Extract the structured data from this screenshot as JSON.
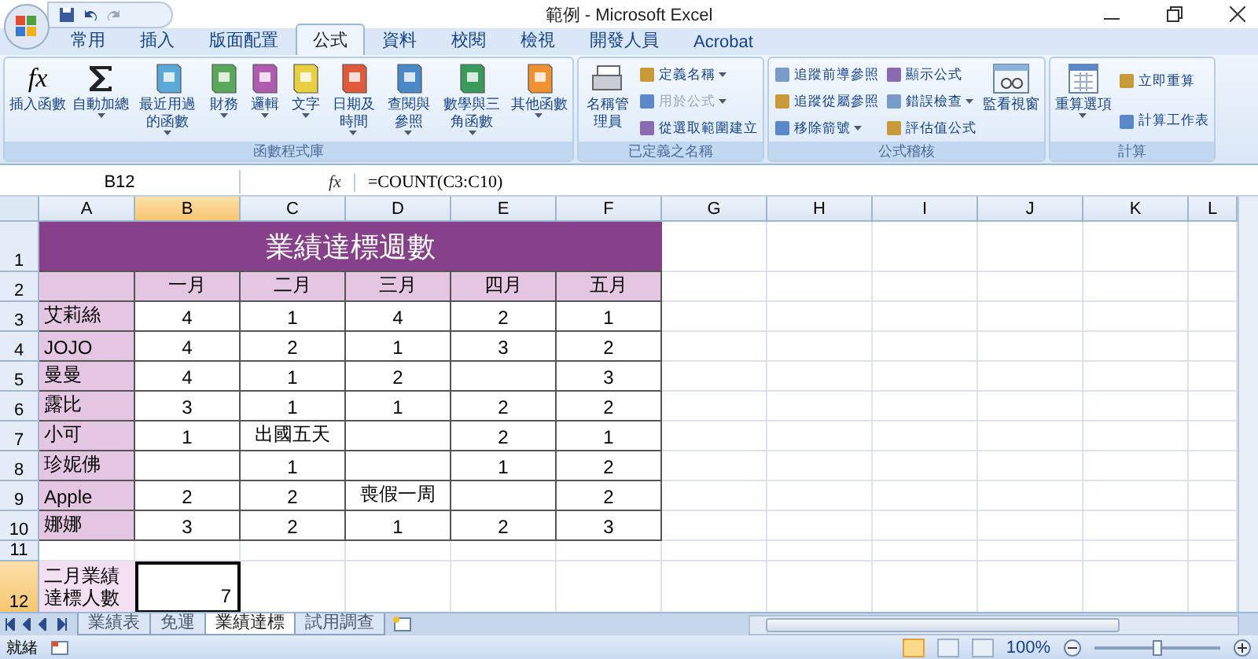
{
  "window": {
    "title": "範例 - Microsoft Excel"
  },
  "tabs": [
    {
      "label": "常用",
      "selected": false
    },
    {
      "label": "插入",
      "selected": false
    },
    {
      "label": "版面配置",
      "selected": false
    },
    {
      "label": "公式",
      "selected": true
    },
    {
      "label": "資料",
      "selected": false
    },
    {
      "label": "校閱",
      "selected": false
    },
    {
      "label": "檢視",
      "selected": false
    },
    {
      "label": "開發人員",
      "selected": false
    },
    {
      "label": "Acrobat",
      "selected": false
    }
  ],
  "ribbon": [
    {
      "label": "函數程式庫",
      "items": [
        {
          "kind": "fx",
          "glyph": "fx",
          "label": "插入函數",
          "dropdown": false
        },
        {
          "kind": "sum",
          "label": "自動加總",
          "dropdown": true
        },
        {
          "kind": "book",
          "color": "#5aa8d8",
          "label": "最近用過的函數",
          "dropdown": true
        },
        {
          "kind": "book",
          "color": "#5aa85a",
          "label": "財務",
          "dropdown": true
        },
        {
          "kind": "book",
          "color": "#b05ab0",
          "label": "邏輯",
          "dropdown": true
        },
        {
          "kind": "book",
          "color": "#e8d040",
          "label": "文字",
          "dropdown": true
        },
        {
          "kind": "book",
          "color": "#e05a3a",
          "label": "日期及時間",
          "dropdown": true
        },
        {
          "kind": "book",
          "color": "#4a88c8",
          "label": "查閱與參照",
          "dropdown": true
        },
        {
          "kind": "book",
          "color": "#3a9a5a",
          "label": "數學與三角函數",
          "dropdown": true
        },
        {
          "kind": "book",
          "color": "#f09030",
          "label": "其他函數",
          "dropdown": true
        }
      ]
    },
    {
      "label": "已定義之名稱",
      "items": [
        {
          "kind": "names",
          "label": "名稱管理員",
          "dropdown": false
        },
        {
          "kind": "small",
          "label": "定義名稱",
          "dropdown": true,
          "disabled": false
        },
        {
          "kind": "small",
          "label": "用於公式",
          "dropdown": true,
          "disabled": true
        },
        {
          "kind": "small",
          "label": "從選取範圍建立",
          "dropdown": false,
          "disabled": false
        }
      ]
    },
    {
      "label": "公式稽核",
      "items": [
        {
          "kind": "small",
          "label": "追蹤前導參照",
          "dropdown": false,
          "disabled": false
        },
        {
          "kind": "small",
          "label": "追蹤從屬參照",
          "dropdown": false,
          "disabled": false
        },
        {
          "kind": "small",
          "label": "移除箭號",
          "dropdown": true,
          "disabled": false
        },
        {
          "kind": "small",
          "label": "顯示公式",
          "dropdown": false,
          "disabled": false
        },
        {
          "kind": "small",
          "label": "錯誤檢查",
          "dropdown": true,
          "disabled": false
        },
        {
          "kind": "small",
          "label": "評估值公式",
          "dropdown": false,
          "disabled": false
        },
        {
          "kind": "watch",
          "label": "監看視窗",
          "dropdown": false
        }
      ]
    },
    {
      "label": "計算",
      "items": [
        {
          "kind": "calc",
          "label": "重算選項",
          "dropdown": true
        },
        {
          "kind": "small",
          "label": "立即重算",
          "dropdown": false,
          "disabled": false
        },
        {
          "kind": "small",
          "label": "計算工作表",
          "dropdown": false,
          "disabled": false
        }
      ]
    }
  ],
  "formula_bar": {
    "name_box": "B12",
    "button": "fx",
    "formula": "=COUNT(C3:C10)"
  },
  "columns": [
    {
      "label": "A",
      "selected": false
    },
    {
      "label": "B",
      "selected": true
    },
    {
      "label": "C",
      "selected": false
    },
    {
      "label": "D",
      "selected": false
    },
    {
      "label": "E",
      "selected": false
    },
    {
      "label": "F",
      "selected": false
    },
    {
      "label": "G",
      "selected": false
    },
    {
      "label": "H",
      "selected": false
    },
    {
      "label": "I",
      "selected": false
    },
    {
      "label": "J",
      "selected": false
    },
    {
      "label": "K",
      "selected": false
    },
    {
      "label": "L",
      "selected": false
    }
  ],
  "rows": [
    {
      "label": "1",
      "selected": false
    },
    {
      "label": "2",
      "selected": false
    },
    {
      "label": "3",
      "selected": false
    },
    {
      "label": "4",
      "selected": false
    },
    {
      "label": "5",
      "selected": false
    },
    {
      "label": "6",
      "selected": false
    },
    {
      "label": "7",
      "selected": false
    },
    {
      "label": "8",
      "selected": false
    },
    {
      "label": "9",
      "selected": false
    },
    {
      "label": "10",
      "selected": false
    },
    {
      "label": "11",
      "selected": false
    },
    {
      "label": "12",
      "selected": true
    }
  ],
  "table": {
    "title": "業績達標週數",
    "months": [
      "一月",
      "二月",
      "三月",
      "四月",
      "五月"
    ],
    "records": [
      {
        "name": "艾莉絲",
        "values": {
          "m1": "4",
          "m2": "1",
          "m3": "4",
          "m4": "2",
          "m5": "1"
        }
      },
      {
        "name": "JOJO",
        "values": {
          "m1": "4",
          "m2": "2",
          "m3": "1",
          "m4": "3",
          "m5": "2"
        }
      },
      {
        "name": "曼曼",
        "values": {
          "m1": "4",
          "m2": "1",
          "m3": "2",
          "m5": "3"
        }
      },
      {
        "name": "露比",
        "values": {
          "m1": "3",
          "m2": "1",
          "m3": "1",
          "m4": "2",
          "m5": "2"
        }
      },
      {
        "name": "小可",
        "values": {
          "m1": "1",
          "m2": "出國五天",
          "m4": "2",
          "m5": "1"
        }
      },
      {
        "name": "珍妮佛",
        "values": {
          "m2": "1",
          "m4": "1",
          "m5": "2"
        }
      },
      {
        "name": "Apple",
        "values": {
          "m1": "2",
          "m2": "2",
          "m3": "喪假一周",
          "m5": "2"
        }
      },
      {
        "name": "娜娜",
        "values": {
          "m1": "3",
          "m2": "2",
          "m3": "1",
          "m4": "2",
          "m5": "3"
        }
      }
    ]
  },
  "summary": {
    "label": "二月業績達標人數",
    "value": "7",
    "selected": true
  },
  "sheet_tabs": [
    {
      "label": "業績表",
      "selected": false
    },
    {
      "label": "免運",
      "selected": false
    },
    {
      "label": "業績達標",
      "selected": true
    },
    {
      "label": "試用調查",
      "selected": false
    }
  ],
  "status_bar": {
    "text": "就緒",
    "views": [
      {
        "selected": true
      },
      {
        "selected": false
      },
      {
        "selected": false
      }
    ],
    "zoom": "100%",
    "zoom_slider": {
      "level": 0.5
    }
  }
}
